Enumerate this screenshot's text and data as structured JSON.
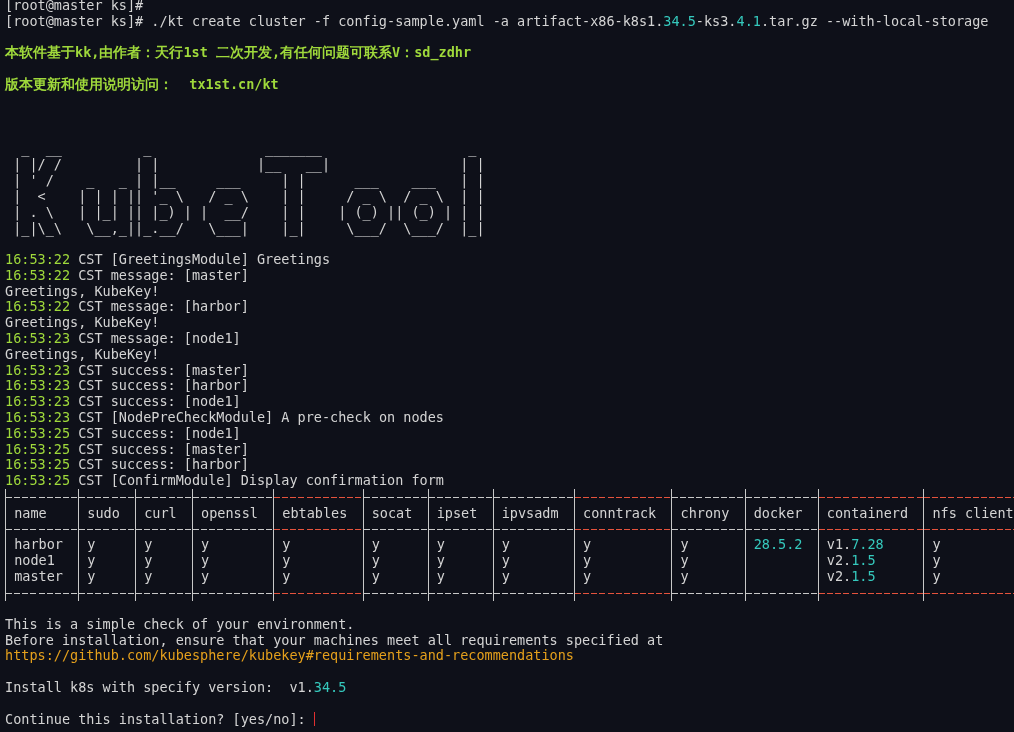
{
  "terminal": {
    "lines": [
      {
        "kind": "prompt",
        "parts": [
          {
            "text": "[root@master ks]#"
          }
        ]
      },
      {
        "kind": "prompt",
        "parts": [
          {
            "text": "[root@master ks]# ./kt create cluster -f config-sample.yaml -a artifact-x86-k8s1."
          },
          {
            "text": "34.5",
            "highlighted": true
          },
          {
            "text": "-ks3."
          },
          {
            "text": "4.1",
            "highlighted": true
          },
          {
            "text": ".tar.gz --with-local-storage"
          }
        ]
      },
      {
        "kind": "blank"
      },
      {
        "kind": "notice",
        "text": "本软件基于kk,由作者：天行1st 二次开发,有任何问题可联系V：sd_zdhr"
      },
      {
        "kind": "blank"
      },
      {
        "kind": "notice",
        "text": "版本更新和使用说明访问：  tx1st.cn/kt"
      },
      {
        "kind": "blank"
      },
      {
        "kind": "blank"
      },
      {
        "kind": "blank"
      },
      {
        "kind": "art",
        "rows": [
          "  _  __          _              _______                  _",
          " | |/ /         | |            |__   __|                | |",
          " | ' /    _   _ | |__     ___     | |      ___    ___   | |",
          " |  <    | | | || '_ \\   / _ \\    | |     / _ \\  / _ \\  | |",
          " | . \\   | |_| || |_) | |  __/    | |    | (_) || (_) | | |",
          " |_|\\_\\   \\__,_||_.__/   \\___|    |_|     \\___/  \\___/  |_|"
        ]
      },
      {
        "kind": "blank"
      },
      {
        "kind": "log",
        "time": "16:53:22",
        "message": "CST [GreetingsModule] Greetings"
      },
      {
        "kind": "log",
        "time": "16:53:22",
        "message": "CST message: [master]"
      },
      {
        "kind": "text",
        "parts": [
          {
            "text": "Greetings, KubeKey!"
          }
        ]
      },
      {
        "kind": "log",
        "time": "16:53:22",
        "message": "CST message: [harbor]"
      },
      {
        "kind": "text",
        "parts": [
          {
            "text": "Greetings, KubeKey!"
          }
        ]
      },
      {
        "kind": "log",
        "time": "16:53:23",
        "message": "CST message: [node1]"
      },
      {
        "kind": "text",
        "parts": [
          {
            "text": "Greetings, KubeKey!"
          }
        ]
      },
      {
        "kind": "log",
        "time": "16:53:23",
        "message": "CST success: [master]"
      },
      {
        "kind": "log",
        "time": "16:53:23",
        "message": "CST success: [harbor]"
      },
      {
        "kind": "log",
        "time": "16:53:23",
        "message": "CST success: [node1]"
      },
      {
        "kind": "log",
        "time": "16:53:23",
        "message": "CST [NodePreCheckModule] A pre-check on nodes"
      },
      {
        "kind": "log",
        "time": "16:53:25",
        "message": "CST success: [node1]"
      },
      {
        "kind": "log",
        "time": "16:53:25",
        "message": "CST success: [master]"
      },
      {
        "kind": "log",
        "time": "16:53:25",
        "message": "CST success: [harbor]"
      },
      {
        "kind": "log",
        "time": "16:53:25",
        "message": "CST [ConfirmModule] Display confirmation form"
      },
      {
        "kind": "table",
        "columns": [
          {
            "label": "name",
            "flagged": false
          },
          {
            "label": "sudo",
            "flagged": false
          },
          {
            "label": "curl",
            "flagged": false
          },
          {
            "label": "openssl",
            "flagged": false
          },
          {
            "label": "ebtables",
            "flagged": true
          },
          {
            "label": "socat",
            "flagged": false
          },
          {
            "label": "ipset",
            "flagged": false
          },
          {
            "label": "ipvsadm",
            "flagged": false
          },
          {
            "label": "conntrack",
            "flagged": true
          },
          {
            "label": "chrony",
            "flagged": false
          },
          {
            "label": "docker",
            "flagged": false
          },
          {
            "label": "containerd",
            "flagged": true
          },
          {
            "label": "nfs client",
            "flagged": true
          }
        ],
        "rows": [
          [
            [
              {
                "text": "harbor"
              }
            ],
            [
              {
                "text": "y"
              }
            ],
            [
              {
                "text": "y"
              }
            ],
            [
              {
                "text": "y"
              }
            ],
            [
              {
                "text": "y"
              }
            ],
            [
              {
                "text": "y"
              }
            ],
            [
              {
                "text": "y"
              }
            ],
            [
              {
                "text": "y"
              }
            ],
            [
              {
                "text": "y"
              }
            ],
            [
              {
                "text": "y"
              }
            ],
            [
              {
                "text": "28.5.2",
                "highlighted": true
              }
            ],
            [
              {
                "text": "v1."
              },
              {
                "text": "7.28",
                "highlighted": true
              }
            ],
            [
              {
                "text": "y"
              }
            ]
          ],
          [
            [
              {
                "text": "node1"
              }
            ],
            [
              {
                "text": "y"
              }
            ],
            [
              {
                "text": "y"
              }
            ],
            [
              {
                "text": "y"
              }
            ],
            [
              {
                "text": "y"
              }
            ],
            [
              {
                "text": "y"
              }
            ],
            [
              {
                "text": "y"
              }
            ],
            [
              {
                "text": "y"
              }
            ],
            [
              {
                "text": "y"
              }
            ],
            [
              {
                "text": "y"
              }
            ],
            [],
            [
              {
                "text": "v2."
              },
              {
                "text": "1.5",
                "highlighted": true
              }
            ],
            [
              {
                "text": "y"
              }
            ]
          ],
          [
            [
              {
                "text": "master"
              }
            ],
            [
              {
                "text": "y"
              }
            ],
            [
              {
                "text": "y"
              }
            ],
            [
              {
                "text": "y"
              }
            ],
            [
              {
                "text": "y"
              }
            ],
            [
              {
                "text": "y"
              }
            ],
            [
              {
                "text": "y"
              }
            ],
            [
              {
                "text": "y"
              }
            ],
            [
              {
                "text": "y"
              }
            ],
            [
              {
                "text": "y"
              }
            ],
            [],
            [
              {
                "text": "v2."
              },
              {
                "text": "1.5",
                "highlighted": true
              }
            ],
            [
              {
                "text": "y"
              }
            ]
          ]
        ]
      },
      {
        "kind": "blank"
      },
      {
        "kind": "text",
        "parts": [
          {
            "text": "This is a simple check of your environment."
          }
        ]
      },
      {
        "kind": "text",
        "parts": [
          {
            "text": "Before installation, ensure that your machines meet all requirements specified at"
          }
        ]
      },
      {
        "kind": "link",
        "text": "https://github.com/kubesphere/kubekey#requirements-and-recommendations"
      },
      {
        "kind": "blank"
      },
      {
        "kind": "text",
        "parts": [
          {
            "text": "Install k8s with specify version:  v1."
          },
          {
            "text": "34.5",
            "highlighted": true
          }
        ]
      },
      {
        "kind": "blank"
      },
      {
        "kind": "input",
        "text": "Continue this installation? [yes/no]: "
      }
    ]
  }
}
